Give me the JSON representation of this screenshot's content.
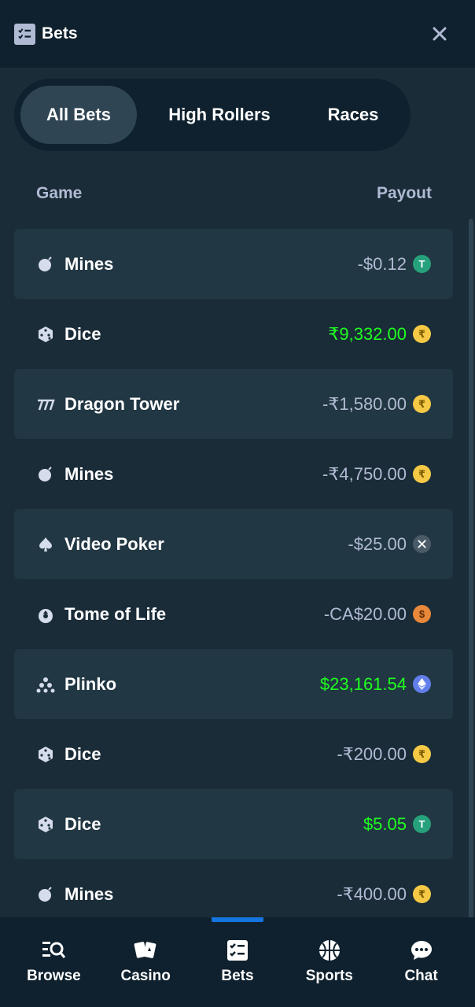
{
  "header": {
    "title": "Bets",
    "icon": "bets-icon",
    "close_icon": "close-icon"
  },
  "tabs": [
    {
      "label": "All Bets",
      "active": true
    },
    {
      "label": "High Rollers",
      "active": false
    },
    {
      "label": "Races",
      "active": false
    }
  ],
  "table": {
    "columns": {
      "game": "Game",
      "payout": "Payout"
    },
    "rows": [
      {
        "game": "Mines",
        "icon": "mines-icon",
        "payout": "-$0.12",
        "win": false,
        "currency": "usdt",
        "currency_icon": "tether-coin-icon"
      },
      {
        "game": "Dice",
        "icon": "dice-icon",
        "payout": "₹9,332.00",
        "win": true,
        "currency": "inr",
        "currency_icon": "rupee-coin-icon"
      },
      {
        "game": "Dragon Tower",
        "icon": "dragon-tower-icon",
        "payout": "-₹1,580.00",
        "win": false,
        "currency": "inr",
        "currency_icon": "rupee-coin-icon"
      },
      {
        "game": "Mines",
        "icon": "mines-icon",
        "payout": "-₹4,750.00",
        "win": false,
        "currency": "inr",
        "currency_icon": "rupee-coin-icon"
      },
      {
        "game": "Video Poker",
        "icon": "spade-icon",
        "payout": "-$25.00",
        "win": false,
        "currency": "xrp",
        "currency_icon": "xrp-coin-icon"
      },
      {
        "game": "Tome of Life",
        "icon": "tome-of-life-icon",
        "payout": "-CA$20.00",
        "win": false,
        "currency": "cad",
        "currency_icon": "cad-coin-icon"
      },
      {
        "game": "Plinko",
        "icon": "plinko-icon",
        "payout": "$23,161.54",
        "win": true,
        "currency": "eth",
        "currency_icon": "ethereum-coin-icon"
      },
      {
        "game": "Dice",
        "icon": "dice-icon",
        "payout": "-₹200.00",
        "win": false,
        "currency": "inr",
        "currency_icon": "rupee-coin-icon"
      },
      {
        "game": "Dice",
        "icon": "dice-icon",
        "payout": "$5.05",
        "win": true,
        "currency": "usdt",
        "currency_icon": "tether-coin-icon"
      },
      {
        "game": "Mines",
        "icon": "mines-icon",
        "payout": "-₹400.00",
        "win": false,
        "currency": "inr",
        "currency_icon": "rupee-coin-icon"
      }
    ]
  },
  "nav": [
    {
      "label": "Browse",
      "icon": "browse-icon",
      "active": false
    },
    {
      "label": "Casino",
      "icon": "casino-cards-icon",
      "active": false
    },
    {
      "label": "Bets",
      "icon": "bets-icon",
      "active": true
    },
    {
      "label": "Sports",
      "icon": "sports-ball-icon",
      "active": false
    },
    {
      "label": "Chat",
      "icon": "chat-icon",
      "active": false
    }
  ],
  "colors": {
    "background": "#1a2c38",
    "header": "#0f212e",
    "row_alt": "#213743",
    "win": "#1fff20",
    "muted": "#b1bad3",
    "accent": "#1475e1"
  }
}
